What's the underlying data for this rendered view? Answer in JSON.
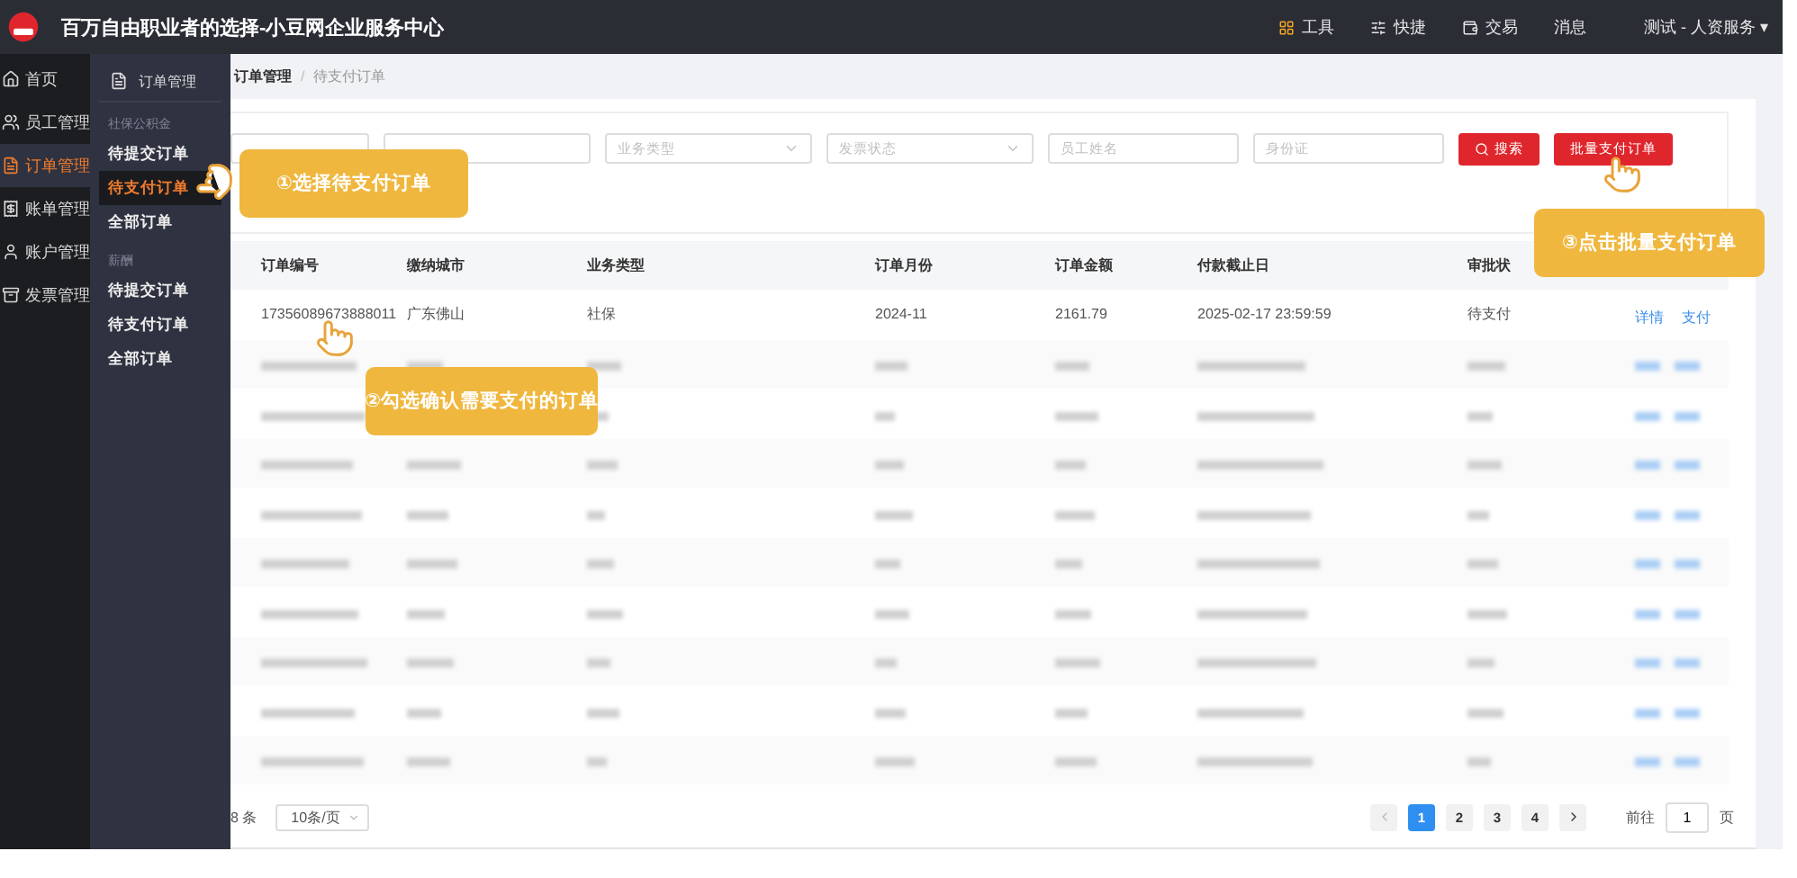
{
  "header": {
    "title": "百万自由职业者的选择-小豆网企业服务中心",
    "actions": [
      {
        "label": "工具"
      },
      {
        "label": "快捷"
      },
      {
        "label": "交易"
      },
      {
        "label": "消息"
      }
    ],
    "user": "测试 - 人资服务",
    "user_caret": "▾"
  },
  "nav": [
    {
      "label": "首页",
      "selected": false
    },
    {
      "label": "员工管理",
      "selected": false
    },
    {
      "label": "订单管理",
      "selected": true
    },
    {
      "label": "账单管理",
      "selected": false
    },
    {
      "label": "账户管理",
      "selected": false
    },
    {
      "label": "发票管理",
      "selected": false
    }
  ],
  "submenu": {
    "title": "订单管理",
    "groups": [
      {
        "label": "社保公积金",
        "items": [
          {
            "label": "待提交订单",
            "selected": false
          },
          {
            "label": "待支付订单",
            "selected": true
          },
          {
            "label": "全部订单",
            "selected": false
          }
        ]
      },
      {
        "label": "薪酬",
        "items": [
          {
            "label": "待提交订单",
            "selected": false
          },
          {
            "label": "待支付订单",
            "selected": false
          },
          {
            "label": "全部订单",
            "selected": false
          }
        ]
      }
    ]
  },
  "breadcrumb": {
    "items": [
      "订单管理",
      "待支付订单"
    ],
    "separator": "/"
  },
  "filters": [
    {
      "kind": "field"
    },
    {
      "kind": "field"
    },
    {
      "kind": "select",
      "placeholder": "业务类型"
    },
    {
      "kind": "select",
      "placeholder": "发票状态"
    },
    {
      "kind": "field",
      "placeholder": "员工姓名"
    },
    {
      "kind": "field",
      "placeholder": "身份证"
    }
  ],
  "buttons": [
    {
      "label": "搜索",
      "kind": "search"
    },
    {
      "label": "批量支付订单",
      "kind": "batch"
    }
  ],
  "table": {
    "columns": [
      "订单编号",
      "缴纳城市",
      "业务类型",
      "订单月份",
      "订单金额",
      "付款截止日",
      "审批状"
    ],
    "rows": [
      {
        "kind": "data",
        "cells": [
          "17356089673888011",
          "广东佛山",
          "社保",
          "2024-11",
          "2161.79",
          "2025-02-17 23:59:59",
          "待支付"
        ],
        "actions": [
          "详情",
          "支付"
        ]
      },
      {
        "kind": "redacted"
      },
      {
        "kind": "redacted"
      },
      {
        "kind": "redacted"
      },
      {
        "kind": "redacted"
      },
      {
        "kind": "redacted"
      },
      {
        "kind": "redacted"
      },
      {
        "kind": "redacted"
      },
      {
        "kind": "redacted"
      },
      {
        "kind": "redacted"
      }
    ]
  },
  "pagination": {
    "total": "8 条",
    "page_size": "10条/页",
    "pages": [
      {
        "label": "1",
        "selected": true
      },
      {
        "label": "2",
        "selected": false
      },
      {
        "label": "3",
        "selected": false
      },
      {
        "label": "4",
        "selected": false
      }
    ],
    "goto_label": "前往",
    "goto_value": "1",
    "goto_suffix": "页"
  },
  "callouts": [
    {
      "text": "①选择待支付订单"
    },
    {
      "text": "②勾选确认需要支付的订单"
    },
    {
      "text": "③点击批量支付订单"
    }
  ]
}
